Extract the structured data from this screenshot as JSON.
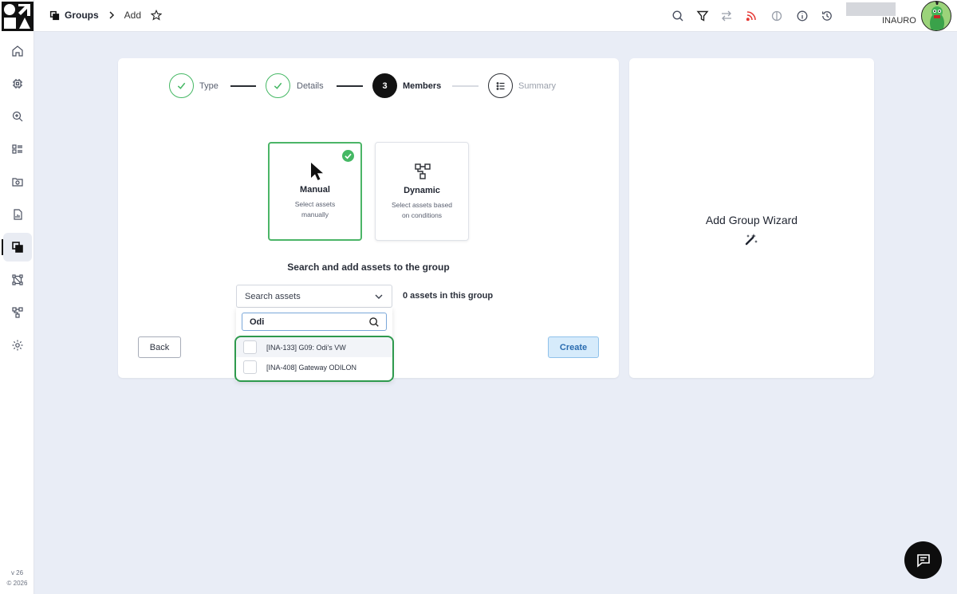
{
  "app": {
    "version": "v 26",
    "copyright": "© 2026"
  },
  "breadcrumb": {
    "section": "Groups",
    "page": "Add"
  },
  "user": {
    "name": "INAURO"
  },
  "stepper": {
    "steps": [
      {
        "label": "Type",
        "state": "done"
      },
      {
        "label": "Details",
        "state": "done"
      },
      {
        "label": "Members",
        "number": "3",
        "state": "current"
      },
      {
        "label": "Summary",
        "state": "future"
      }
    ]
  },
  "modes": [
    {
      "title": "Manual",
      "description_line1": "Select assets",
      "description_line2": "manually",
      "selected": true
    },
    {
      "title": "Dynamic",
      "description_line1": "Select assets based",
      "description_line2": "on conditions",
      "selected": false
    }
  ],
  "members": {
    "heading": "Search and add assets to the group",
    "select_placeholder": "Search assets",
    "count_text": "0 assets in this group",
    "search_value": "Odi",
    "results": [
      {
        "label": "[INA-133] G09: Odi's VW",
        "checked": false
      },
      {
        "label": "[INA-408] Gateway ODILON",
        "checked": false
      }
    ]
  },
  "actions": {
    "back_label": "Back",
    "create_label": "Create"
  },
  "side_panel": {
    "title": "Add Group Wizard"
  },
  "colors": {
    "success": "#45b864",
    "highlight": "#2e9a4d",
    "primary_light": "#d6ebfb",
    "primary_text": "#2a6cb0",
    "rss": "#e53935"
  }
}
